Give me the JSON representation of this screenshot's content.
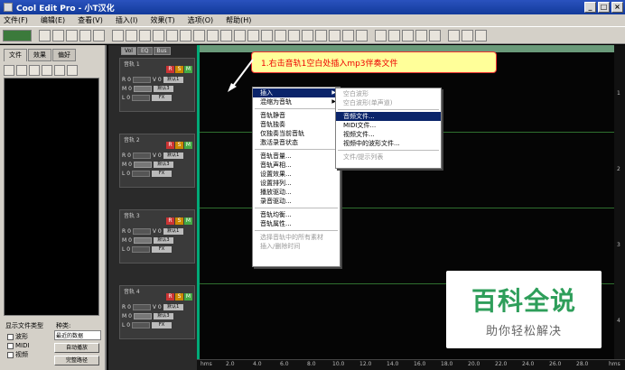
{
  "window": {
    "title": "Cool Edit Pro  - 小T汉化",
    "min": "_",
    "max": "□",
    "close": "×"
  },
  "menu": [
    "文件(F)",
    "编辑(E)",
    "查看(V)",
    "插入(I)",
    "效果(T)",
    "选项(O)",
    "帮助(H)"
  ],
  "left_panel": {
    "tabs": [
      "文件",
      "效果",
      "偏好"
    ],
    "filetype_label": "显示文件类型",
    "sort_label": "种类:",
    "sort_value": "最近的数据",
    "filetypes": [
      "波形",
      "MIDI",
      "视频"
    ],
    "btn_autoplay": "自动播放",
    "btn_full": "完整路径"
  },
  "track_panel": {
    "tabs": [
      "Vol",
      "EQ",
      "Bus"
    ],
    "tracks": [
      {
        "name": "音轨 1"
      },
      {
        "name": "音轨 2"
      },
      {
        "name": "音轨 3"
      },
      {
        "name": "音轨 4"
      }
    ],
    "rsm": [
      "R",
      "S",
      "M"
    ],
    "row_labels": [
      "R 0",
      "V 0",
      "M 0",
      "L 0"
    ],
    "row_buttons": [
      "默认1",
      "默认3",
      "FX"
    ]
  },
  "callout": "1.右击音轨1空白处插入mp3伴奏文件",
  "context_menu": {
    "items": [
      {
        "label": "插入",
        "highlight": true,
        "submenu": true
      },
      {
        "label": "混缩为音轨",
        "submenu": true
      },
      {
        "sep": true
      },
      {
        "label": "音轨静音"
      },
      {
        "label": "音轨独奏"
      },
      {
        "label": "仅独奏当前音轨"
      },
      {
        "label": "激活录音状态"
      },
      {
        "sep": true
      },
      {
        "label": "音轨音量..."
      },
      {
        "label": "音轨声相..."
      },
      {
        "label": "设置效果..."
      },
      {
        "label": "设置排列..."
      },
      {
        "label": "播放驱动..."
      },
      {
        "label": "录音驱动..."
      },
      {
        "sep": true
      },
      {
        "label": "音轨均衡..."
      },
      {
        "label": "音轨属性..."
      },
      {
        "sep": true
      },
      {
        "label": "选择音轨中的所有素材",
        "disabled": true
      },
      {
        "label": "插入/删除时间",
        "disabled": true
      }
    ]
  },
  "submenu": {
    "items": [
      {
        "label": "空白波形",
        "disabled": true
      },
      {
        "label": "空白波形(单声道)",
        "disabled": true
      },
      {
        "sep": true
      },
      {
        "label": "音频文件...",
        "highlight": true
      },
      {
        "label": "MIDI文件..."
      },
      {
        "label": "视频文件..."
      },
      {
        "label": "视频中的波形文件..."
      },
      {
        "sep": true
      },
      {
        "label": "文件/提示列表",
        "disabled": true
      }
    ]
  },
  "ruler": {
    "ticks": [
      "hms",
      "2.0",
      "4.0",
      "6.0",
      "8.0",
      "10.0",
      "12.0",
      "14.0",
      "16.0",
      "18.0",
      "20.0",
      "22.0",
      "24.0",
      "26.0",
      "28.0",
      "hms"
    ]
  },
  "watermark": {
    "title": "百科全说",
    "subtitle": "助你轻松解决"
  }
}
